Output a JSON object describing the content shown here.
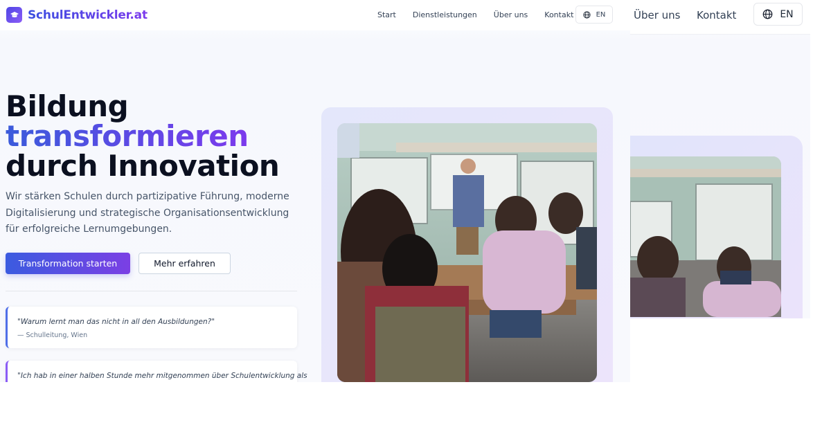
{
  "brand": {
    "name": "SchulEntwickler.at"
  },
  "nav": {
    "items": [
      "Start",
      "Dienstleistungen",
      "Über uns",
      "Kontakt"
    ],
    "lang": "EN"
  },
  "hero": {
    "title_line1": "Bildung",
    "title_line2": "transformieren",
    "title_line3": "durch Innovation",
    "subtitle": "Wir stärken Schulen durch partizipative Führung, moderne Digitalisierung und strategische Organisationsentwicklung für erfolgreiche Lernumgebungen.",
    "primary_button": "Transformation starten",
    "secondary_button": "Mehr erfahren"
  },
  "quotes": [
    {
      "text": "\"Warum lernt man das nicht in all den Ausbildungen?\"",
      "author": "— Schulleitung, Wien"
    },
    {
      "text": "\"Ich hab in einer halben Stunde mehr mitgenommen über Schulentwicklung als"
    }
  ],
  "zoom_strip": {
    "link1": "Über uns",
    "link2": "Kontakt",
    "lang": "EN"
  },
  "colors": {
    "brand": "#4f46e5",
    "accent": "#7c3aed"
  }
}
